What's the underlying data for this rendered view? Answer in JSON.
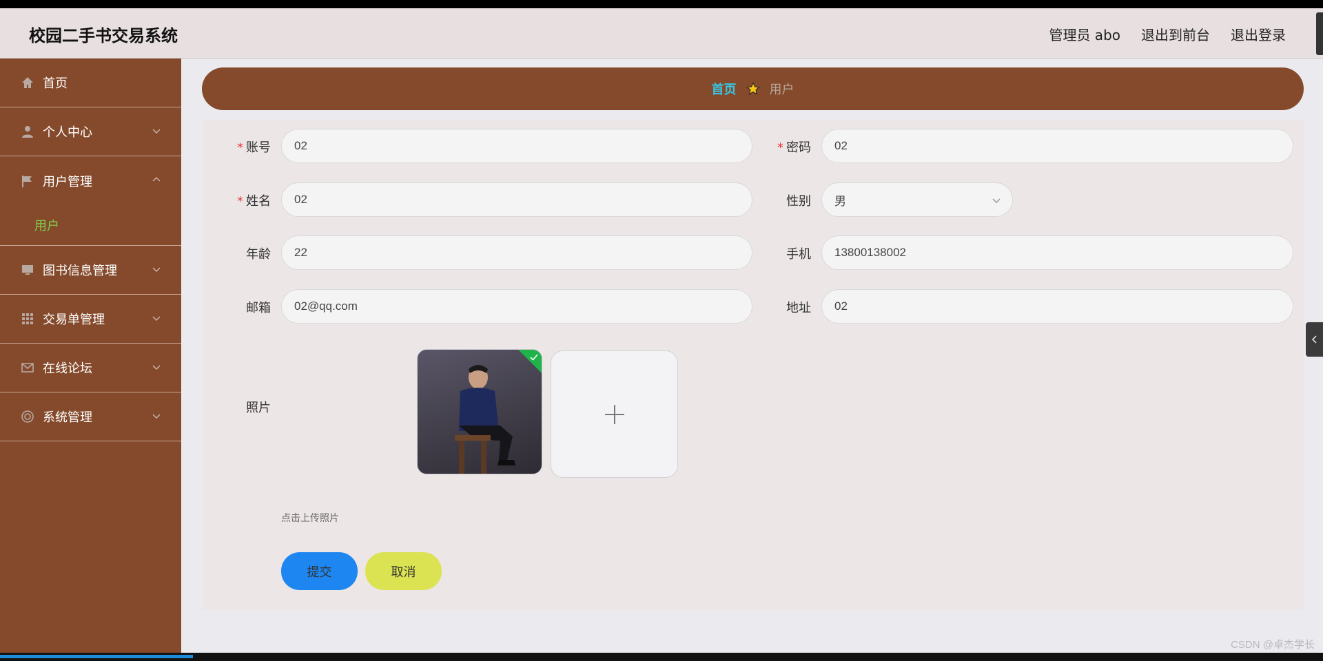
{
  "app": {
    "title": "校园二手书交易系统"
  },
  "header": {
    "links": [
      "管理员 abo",
      "退出到前台",
      "退出登录"
    ]
  },
  "sidebar": {
    "items": [
      {
        "label": "首页",
        "icon": "home-icon"
      },
      {
        "label": "个人中心",
        "icon": "user-icon"
      },
      {
        "label": "用户管理",
        "icon": "flag-icon",
        "expanded": true,
        "children": [
          "用户"
        ]
      },
      {
        "label": "图书信息管理",
        "icon": "monitor-icon"
      },
      {
        "label": "交易单管理",
        "icon": "grid-icon"
      },
      {
        "label": "在线论坛",
        "icon": "mail-icon"
      },
      {
        "label": "系统管理",
        "icon": "settings-icon"
      }
    ]
  },
  "breadcrumb": {
    "home": "首页",
    "current": "用户"
  },
  "form": {
    "account": {
      "label": "账号",
      "value": "02",
      "required": true
    },
    "password": {
      "label": "密码",
      "value": "02",
      "required": true
    },
    "name": {
      "label": "姓名",
      "value": "02",
      "required": true
    },
    "gender": {
      "label": "性别",
      "value": "男"
    },
    "age": {
      "label": "年龄",
      "value": "22"
    },
    "phone": {
      "label": "手机",
      "value": "13800138002"
    },
    "email": {
      "label": "邮箱",
      "value": "02@qq.com"
    },
    "address": {
      "label": "地址",
      "value": "02"
    },
    "photo": {
      "label": "照片",
      "hint": "点击上传照片"
    },
    "submit_label": "提交",
    "cancel_label": "取消"
  },
  "watermark": "CSDN @卓杰学长",
  "colors": {
    "sidebar": "#854a2c",
    "accent_link": "#35c8e8",
    "submenu_active": "#7fd04b",
    "submit": "#1d86f0",
    "cancel": "#dce352"
  }
}
